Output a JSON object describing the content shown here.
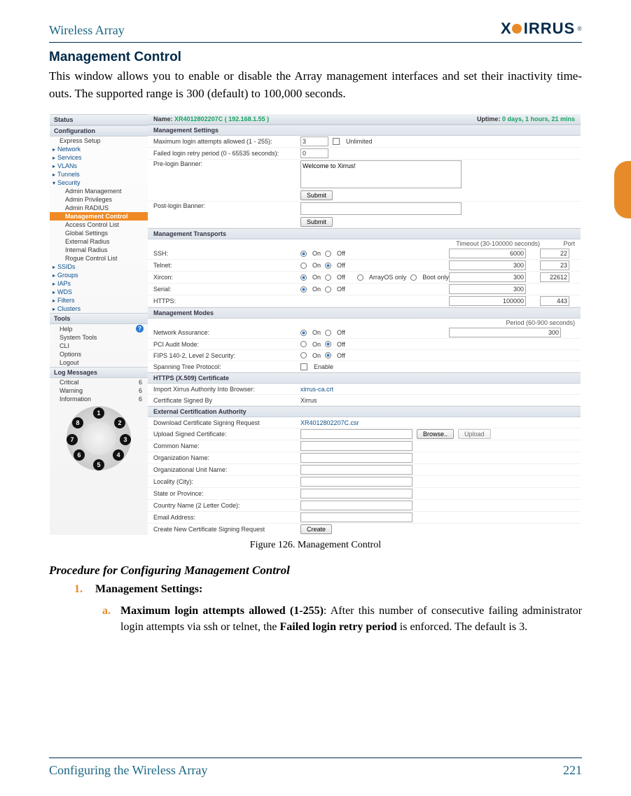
{
  "header": {
    "product": "Wireless Array",
    "logo_word": "IRRUS"
  },
  "page": {
    "section_title": "Management Control",
    "intro": "This window allows you to enable or disable the Array management interfaces and set their inactivity time-outs. The supported range is 300 (default) to 100,000 seconds.",
    "caption": "Figure 126. Management Control",
    "subtitle": "Procedure for Configuring Management Control",
    "step1_num": "1.",
    "step1_text": "Management Settings:",
    "stepA_num": "a.",
    "stepA_bold1": "Maximum login attempts allowed (1-255)",
    "stepA_rest1": ": After this number of consecutive failing administrator login attempts via ssh or telnet, the ",
    "stepA_bold2": "Failed login retry period",
    "stepA_rest2": " is enforced. The default is 3."
  },
  "footer": {
    "left": "Configuring the Wireless Array",
    "page_number": "221"
  },
  "shot": {
    "name_label": "Name:",
    "device_name": "XR4012802207C",
    "device_ip": "( 192.168.1.55 )",
    "uptime_label": "Uptime:",
    "uptime_value": "0 days, 1 hours, 21 mins",
    "sidebar": {
      "status": "Status",
      "configuration": "Configuration",
      "items_top": [
        "Express Setup",
        "Network",
        "Services",
        "VLANs",
        "Tunnels",
        "Security"
      ],
      "security_sub": [
        "Admin Management",
        "Admin Privileges",
        "Admin RADIUS"
      ],
      "active": "Management Control",
      "security_sub2": [
        "Access Control List",
        "Global Settings",
        "External Radius",
        "Internal Radius",
        "Rogue Control List"
      ],
      "items_bottom": [
        "SSIDs",
        "Groups",
        "IAPs",
        "WDS",
        "Filters",
        "Clusters"
      ],
      "tools": "Tools",
      "tools_items": [
        "Help",
        "System Tools",
        "CLI",
        "Options",
        "Logout"
      ],
      "log_header": "Log Messages",
      "logs": [
        {
          "label": "Critical",
          "count": "6"
        },
        {
          "label": "Warning",
          "count": "6"
        },
        {
          "label": "Information",
          "count": "6"
        }
      ]
    },
    "groups": {
      "mgmt_settings": "Management Settings",
      "mgmt_transports": "Management Transports",
      "mgmt_modes": "Management Modes",
      "https_cert": "HTTPS (X.509) Certificate",
      "ext_ca": "External Certification Authority"
    },
    "settings": {
      "max_attempts_label": "Maximum login attempts allowed (1 - 255):",
      "max_attempts_value": "3",
      "unlimited_label": "Unlimited",
      "retry_label": "Failed login retry period (0 - 65535 seconds):",
      "retry_value": "0",
      "prelogin_label": "Pre-login Banner:",
      "prelogin_value": "Welcome to Xirrus!",
      "postlogin_label": "Post-login Banner:",
      "submit": "Submit"
    },
    "transports": {
      "timeout_header": "Timeout (30-100000 seconds)",
      "port_header": "Port",
      "on": "On",
      "off": "Off",
      "arrayos": "ArrayOS only",
      "boot": "Boot only",
      "rows": {
        "ssh": {
          "label": "SSH:",
          "on": true,
          "timeout": "6000",
          "port": "22"
        },
        "telnet": {
          "label": "Telnet:",
          "on": false,
          "timeout": "300",
          "port": "23"
        },
        "xircon": {
          "label": "Xircon:",
          "on": true,
          "timeout": "300",
          "port": "22612"
        },
        "serial": {
          "label": "Serial:",
          "on": true,
          "timeout": "300",
          "port": ""
        },
        "https": {
          "label": "HTTPS:",
          "timeout": "100000",
          "port": "443"
        }
      }
    },
    "modes": {
      "period_header": "Period (60-900 seconds)",
      "net_assurance_label": "Network Assurance:",
      "net_assurance_period": "300",
      "pci_label": "PCI Audit Mode:",
      "fips_label": "FIPS 140-2, Level 2 Security:",
      "stp_label": "Spanning Tree Protocol:",
      "enable_label": "Enable"
    },
    "cert": {
      "import_label": "Import Xirrus Authority Into Browser:",
      "import_value": "xirrus-ca.crt",
      "signed_by_label": "Certificate Signed By",
      "signed_by_value": "Xirrus"
    },
    "extca": {
      "download_label": "Download Certificate Signing Request",
      "download_value": "XR4012802207C.csr",
      "upload_label": "Upload Signed Certificate:",
      "browse": "Browse..",
      "upload": "Upload",
      "fields": {
        "cn": "Common Name:",
        "org": "Organization Name:",
        "ou": "Organizational Unit Name:",
        "city": "Locality (City):",
        "state": "State or Province:",
        "country": "Country Name (2 Letter Code):",
        "email": "Email Address:",
        "create": "Create New Certificate Signing Request"
      },
      "create_btn": "Create"
    }
  }
}
